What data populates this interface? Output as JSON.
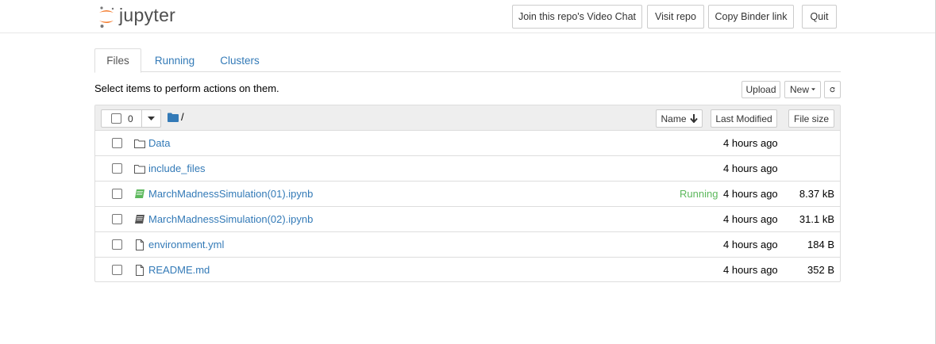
{
  "header": {
    "logo_text": "jupyter",
    "buttons": [
      {
        "label": "Join this repo's Video Chat"
      },
      {
        "label": "Visit repo"
      },
      {
        "label": "Copy Binder link"
      },
      {
        "label": "Quit"
      }
    ]
  },
  "tabs": [
    {
      "label": "Files",
      "active": true
    },
    {
      "label": "Running",
      "active": false
    },
    {
      "label": "Clusters",
      "active": false
    }
  ],
  "toolbar": {
    "hint": "Select items to perform actions on them.",
    "upload_label": "Upload",
    "new_label": "New",
    "refresh_icon": "refresh-icon"
  },
  "list_header": {
    "selected_count": "0",
    "path": "/",
    "sort_name_label": "Name",
    "sort_modified_label": "Last Modified",
    "sort_size_label": "File size"
  },
  "files": [
    {
      "name": "Data",
      "type": "folder",
      "icon": "folder-icon",
      "status": "",
      "modified": "4 hours ago",
      "size": ""
    },
    {
      "name": "include_files",
      "type": "folder",
      "icon": "folder-icon",
      "status": "",
      "modified": "4 hours ago",
      "size": ""
    },
    {
      "name": "MarchMadnessSimulation(01).ipynb",
      "type": "notebook",
      "icon": "notebook-running-icon",
      "status": "Running",
      "modified": "4 hours ago",
      "size": "8.37 kB"
    },
    {
      "name": "MarchMadnessSimulation(02).ipynb",
      "type": "notebook",
      "icon": "notebook-icon",
      "status": "",
      "modified": "4 hours ago",
      "size": "31.1 kB"
    },
    {
      "name": "environment.yml",
      "type": "file",
      "icon": "file-icon",
      "status": "",
      "modified": "4 hours ago",
      "size": "184 B"
    },
    {
      "name": "README.md",
      "type": "file",
      "icon": "file-icon",
      "status": "",
      "modified": "4 hours ago",
      "size": "352 B"
    }
  ],
  "colors": {
    "link": "#337ab7",
    "running": "#5cb85c",
    "logo_orange": "#f37726",
    "notebook_running": "#5cb85c",
    "notebook_idle": "#555555"
  }
}
